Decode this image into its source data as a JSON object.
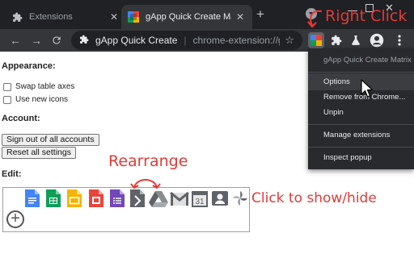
{
  "browser": {
    "tabs": [
      {
        "title": "Extensions",
        "icon": "puzzle-icon",
        "active": false
      },
      {
        "title": "gApp Quick Create Ma",
        "icon": "gapp-icon",
        "active": true
      }
    ],
    "new_tab_glyph": "+",
    "omnibox": {
      "site": "gApp Quick Create",
      "url": "chrome-extension://gic"
    }
  },
  "page": {
    "appearance_heading": "Appearance:",
    "options": [
      {
        "label": "Swap table axes",
        "checked": false
      },
      {
        "label": "Use new icons",
        "checked": false
      }
    ],
    "account_heading": "Account:",
    "sign_out_label": "Sign out of all accounts",
    "reset_label": "Reset all settings",
    "edit_heading": "Edit:",
    "apps": [
      {
        "name": "docs",
        "icon": "google-docs-icon",
        "visible": true
      },
      {
        "name": "sheets",
        "icon": "google-sheets-icon",
        "visible": true
      },
      {
        "name": "slides",
        "icon": "google-slides-icon",
        "visible": true
      },
      {
        "name": "jamboard",
        "icon": "jamboard-icon",
        "visible": true
      },
      {
        "name": "forms",
        "icon": "google-forms-icon",
        "visible": true
      },
      {
        "name": "keep",
        "icon": "gray-doc-icon",
        "visible": false
      },
      {
        "name": "drive",
        "icon": "google-drive-icon",
        "visible": false
      },
      {
        "name": "gmail",
        "icon": "gmail-icon",
        "visible": false
      },
      {
        "name": "calendar",
        "icon": "calendar-icon",
        "visible": false,
        "label": "31"
      },
      {
        "name": "contacts",
        "icon": "contacts-icon",
        "visible": false
      },
      {
        "name": "photos",
        "icon": "photos-icon",
        "visible": false
      }
    ],
    "add_glyph": "+"
  },
  "annotations": {
    "right_click": "Right Click",
    "rearrange": "Rearrange",
    "click_show_hide": "Click to show/hide"
  },
  "context_menu": {
    "title": "gApp Quick Create Matrix",
    "items": [
      "Options",
      "Remove from Chrome...",
      "Unpin"
    ],
    "manage": "Manage extensions",
    "inspect": "Inspect popup",
    "hovered": "Options"
  },
  "colors": {
    "annotation": "#e53935",
    "docs": "#4285f4",
    "sheets": "#0f9d58",
    "slides": "#f4b400",
    "jamboard": "#e8453c",
    "forms": "#7248b9"
  }
}
